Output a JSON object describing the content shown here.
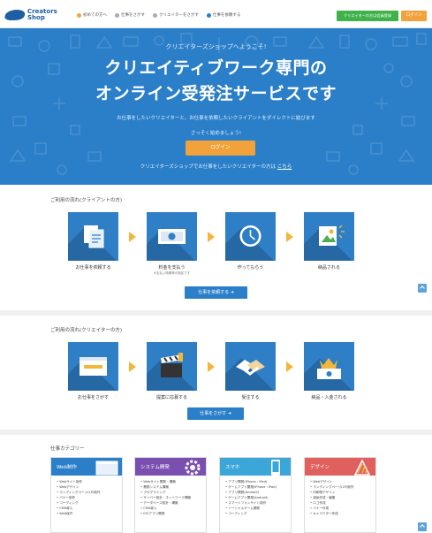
{
  "header": {
    "logo_line1": "Creators",
    "logo_line2": "Shop",
    "nav": [
      {
        "label": "初めての方へ",
        "icon": "star-icon",
        "color": "#f2a23a"
      },
      {
        "label": "仕事をさがす",
        "icon": "search-icon",
        "color": "#9aa"
      },
      {
        "label": "クリエイターをさがす",
        "icon": "search-icon",
        "color": "#9aa"
      },
      {
        "label": "仕事を依頼する",
        "icon": "plus-icon",
        "color": "#2b7fc8"
      }
    ],
    "register_label": "クリエイターの方は会員登録",
    "login_label": "ログイン"
  },
  "hero": {
    "subtitle": "クリエイターズショップへようこそ!",
    "title_line1": "クリエイティブワーク専門の",
    "title_line2": "オンライン受発注サービスです",
    "description": "お仕事をしたいクリエイターと、お仕事を依頼したいクライアントをダイレクトに結びます",
    "description2": "さっそく始めましょう!",
    "button_label": "ログイン",
    "footer_text": "クリエイターズショップでお仕事をしたいクリエイターの方は",
    "footer_link": "こちら",
    "bg_color": "#2b7fc8"
  },
  "client_flow": {
    "title": "ご利用の流れ(クライアントの方)",
    "steps": [
      {
        "label": "お仕事を依頼する",
        "icon": "document-icon",
        "note": ""
      },
      {
        "label": "料金を支払う",
        "icon": "money-icon",
        "note": "※支払い時期等の指定です"
      },
      {
        "label": "作ってもらう",
        "icon": "clock-icon",
        "note": ""
      },
      {
        "label": "納品される",
        "icon": "delivery-icon",
        "note": ""
      }
    ],
    "button_label": "仕事を依頼する ➜"
  },
  "creator_flow": {
    "title": "ご利用の流れ(クリエイターの方)",
    "steps": [
      {
        "label": "お仕事をさがす",
        "icon": "browser-icon",
        "note": ""
      },
      {
        "label": "提案に応募する",
        "icon": "clapper-icon",
        "note": ""
      },
      {
        "label": "受注する",
        "icon": "handshake-icon",
        "note": ""
      },
      {
        "label": "納品・入金される",
        "icon": "crown-money-icon",
        "note": ""
      }
    ],
    "button_label": "仕事をさがす ➜"
  },
  "categories": {
    "title": "仕事カテゴリー",
    "items": [
      {
        "label": "Web制作",
        "color": "#2b7fc8",
        "links": [
          "Webサイト制作",
          "Webデザイン",
          "ランディングページ(LP)制作",
          "バナー制作",
          "コーディング",
          "CMS導入",
          "Web保守"
        ]
      },
      {
        "label": "システム開発",
        "color": "#7a4fb0",
        "links": [
          "Webサイト開発・構築",
          "業務システム構築",
          "プログラミング",
          "サーバー設計・ネットワーク構築",
          "データベース設計・構築",
          "CMS導入",
          "iOSアプリ開発"
        ]
      },
      {
        "label": "スマホ",
        "color": "#3aa7d8",
        "links": [
          "アプリ開発(iPhone・iPad)",
          "ゲームアプリ開発(iPhone・iPad)",
          "アプリ開発(Android)",
          "ゲームアプリ開発(Android)",
          "スマートフォンサイト制作",
          "ソーシャルゲーム開発",
          "コーディング"
        ]
      },
      {
        "label": "デザイン",
        "color": "#e0605e",
        "links": [
          "Webデザイン",
          "ランディングページ(LP)制作",
          "印刷物デザイン",
          "漫画作成・編集",
          "ロゴ作成",
          "バナー作成",
          "キャラクター作成"
        ]
      }
    ]
  }
}
